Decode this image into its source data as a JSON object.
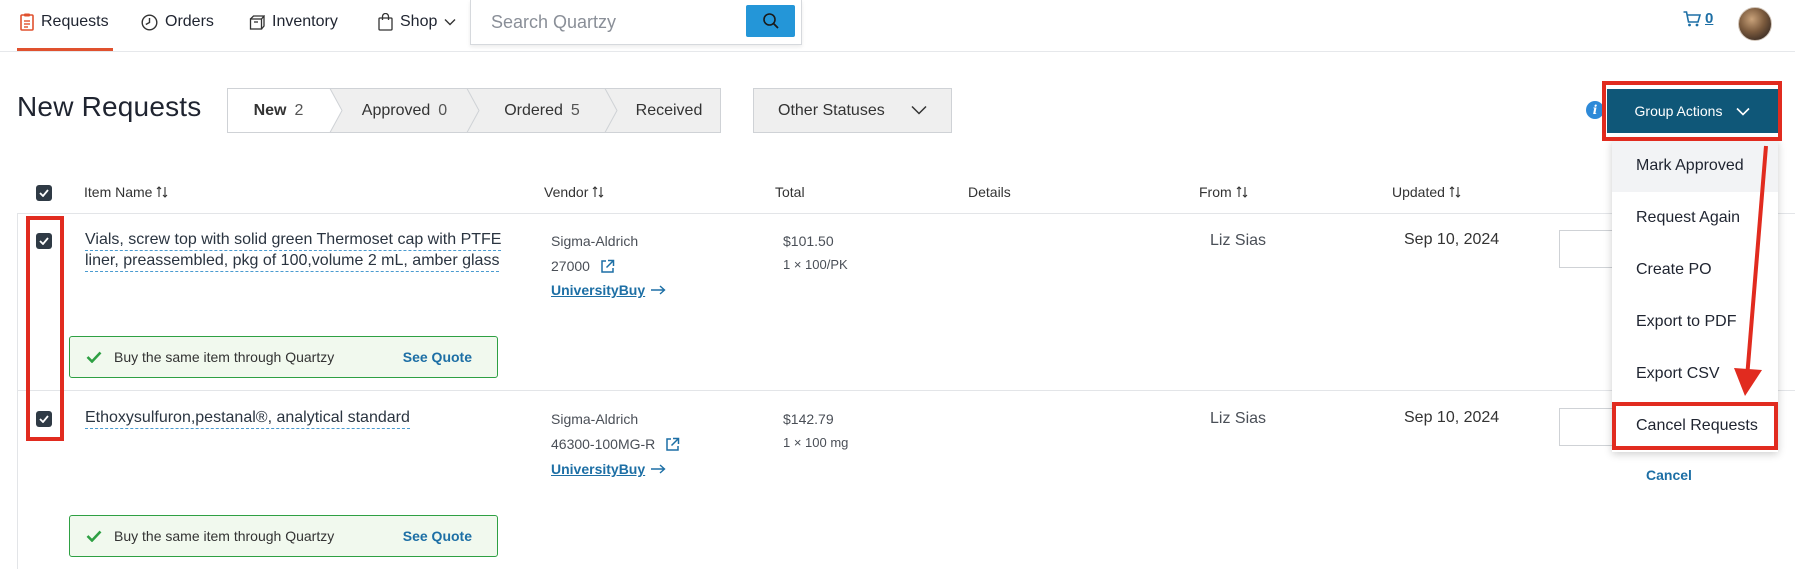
{
  "nav": {
    "requests": "Requests",
    "orders": "Orders",
    "inventory": "Inventory",
    "shop": "Shop",
    "search_placeholder": "Search Quartzy",
    "cart_count": "0"
  },
  "page": {
    "title": "New Requests",
    "other_statuses": "Other Statuses",
    "group_actions": "Group Actions"
  },
  "tabs": [
    {
      "label": "New",
      "count": "2"
    },
    {
      "label": "Approved",
      "count": "0"
    },
    {
      "label": "Ordered",
      "count": "5"
    },
    {
      "label": "Received",
      "count": ""
    }
  ],
  "columns": {
    "item_name": "Item Name",
    "vendor": "Vendor",
    "total": "Total",
    "details": "Details",
    "from": "From",
    "updated": "Updated"
  },
  "rows": [
    {
      "item_line1": "Vials, screw top with solid green Thermoset cap with PTFE",
      "item_line2": "liner, preassembled, pkg of 100,volume 2 mL, amber glass",
      "vendor": "Sigma-Aldrich",
      "catalog": "27000",
      "vendor_link": "UniversityBuy",
      "total": "$101.50",
      "unit": "1 × 100/PK",
      "from": "Liz Sias",
      "updated": "Sep 10, 2024",
      "banner": "Buy the same item through Quartzy",
      "banner_link": "See Quote"
    },
    {
      "item_line1": "Ethoxysulfuron,pestanal®, analytical standard",
      "item_line2": "",
      "vendor": "Sigma-Aldrich",
      "catalog": "46300-100MG-R",
      "vendor_link": "UniversityBuy",
      "total": "$142.79",
      "unit": "1 × 100 mg",
      "from": "Liz Sias",
      "updated": "Sep 10, 2024",
      "banner": "Buy the same item through Quartzy",
      "banner_link": "See Quote"
    }
  ],
  "dropdown": {
    "items": [
      "Mark Approved",
      "Request Again",
      "Create PO",
      "Export to PDF",
      "Export CSV",
      "Cancel Requests"
    ],
    "cancel": "Cancel"
  },
  "colors": {
    "accent": "#0f5778",
    "nav_active": "#e0512e",
    "link": "#1d6fa5",
    "annotation": "#e12b1f",
    "success": "#2ea043"
  }
}
